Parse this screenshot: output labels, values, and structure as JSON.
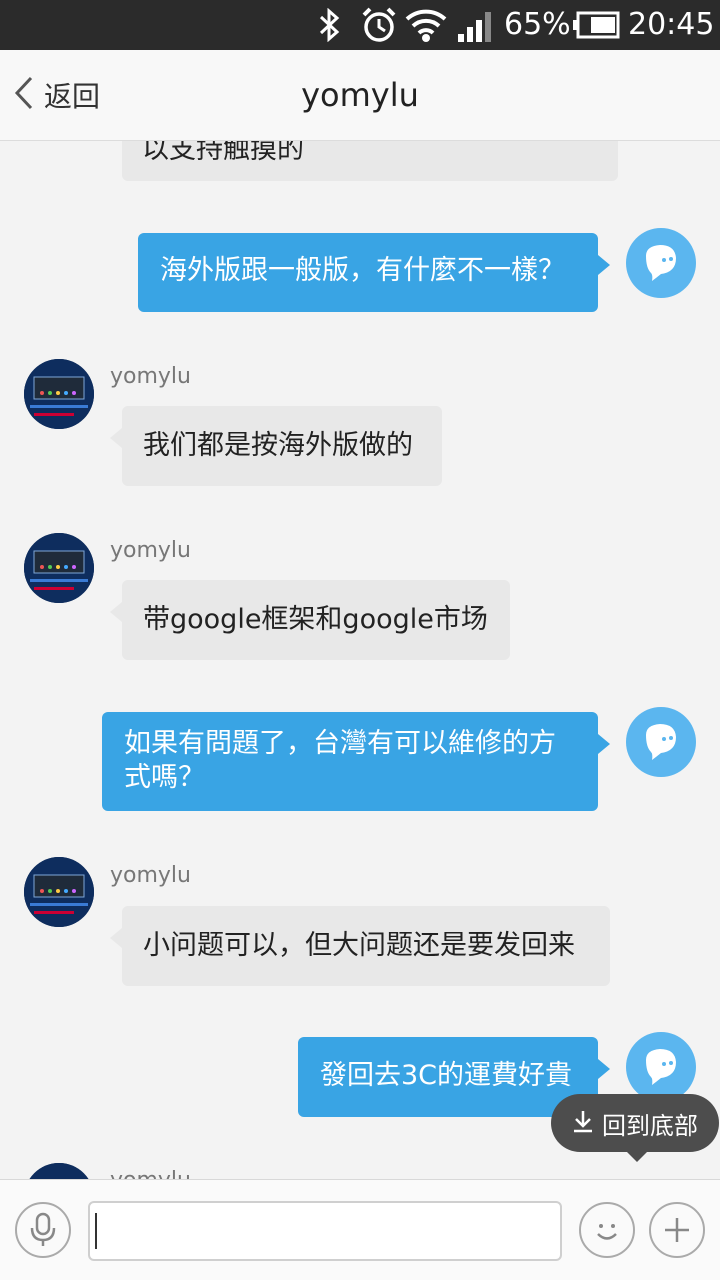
{
  "status_bar": {
    "battery_percent": "65%",
    "time": "20:45",
    "icons": [
      "bluetooth-icon",
      "alarm-icon",
      "wifi-icon",
      "signal-icon",
      "battery-icon"
    ]
  },
  "header": {
    "back_label": "返回",
    "title": "yomylu"
  },
  "messages": [
    {
      "side": "in",
      "text": "以支持触摸的",
      "partial": true
    },
    {
      "side": "out",
      "text": "海外版跟一般版，有什麼不一樣？"
    },
    {
      "side": "in",
      "sender": "yomylu",
      "text": "我们都是按海外版做的"
    },
    {
      "side": "in",
      "sender": "yomylu",
      "text": "带google框架和google市场"
    },
    {
      "side": "out",
      "text": "如果有問題了，台灣有可以維修的方式嗎？"
    },
    {
      "side": "in",
      "sender": "yomylu",
      "text": "小问题可以，但大问题还是要发回来"
    },
    {
      "side": "out",
      "text": "發回去3C的運費好貴"
    },
    {
      "side": "in",
      "sender": "yomylu",
      "text": "",
      "partial": true
    }
  ],
  "scroll_to_bottom_label": "回到底部",
  "input": {
    "value": ""
  },
  "colors": {
    "outgoing_bubble": "#39a4e4",
    "incoming_bubble": "#e8e8e8",
    "status_bar": "#2b2b2b"
  }
}
